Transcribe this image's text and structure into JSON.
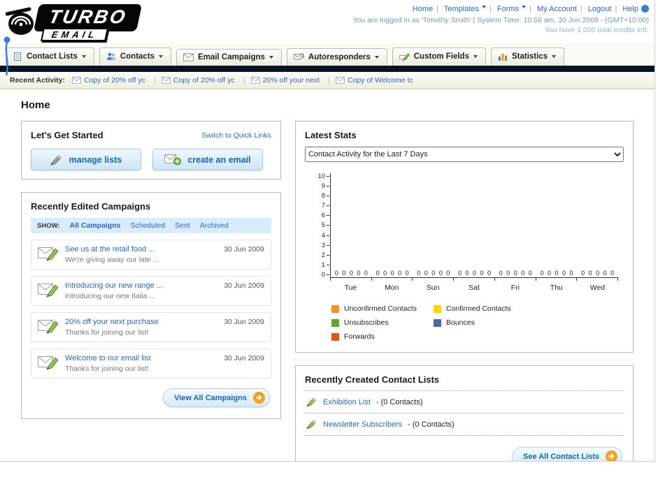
{
  "header": {
    "logo_top": "TURBO",
    "logo_bottom": "EMAIL",
    "links": [
      "Home",
      "Templates",
      "Forms",
      "My Account",
      "Logout",
      "Help"
    ],
    "status_line1": "You are logged in as 'Timothy Smith' | System Time: 10:58 am, 30 Jun 2009 - (GMT+10:00)",
    "status_line2": "You have 1,000 total credits left."
  },
  "nav": {
    "tabs": [
      "Contact Lists",
      "Contacts",
      "Email Campaigns",
      "Autoresponders",
      "Custom Fields",
      "Statistics"
    ]
  },
  "recent_activity": {
    "label": "Recent Activity:",
    "items": [
      {
        "label": "Copy of 20% off yc"
      },
      {
        "label": "Copy of 20% off yc"
      },
      {
        "label": "20% off your next"
      },
      {
        "label": "Copy of Welcome tc"
      }
    ]
  },
  "page": {
    "title": "Home"
  },
  "get_started": {
    "title": "Let's Get Started",
    "switch_link": "Switch to Quick Links",
    "manage_lists_label": "manage lists",
    "create_email_label": "create an email"
  },
  "campaigns": {
    "title": "Recently Edited Campaigns",
    "show_label": "SHOW:",
    "filters": [
      "All Campaigns",
      "Scheduled",
      "Sent",
      "Archived"
    ],
    "items": [
      {
        "title": "See us at the retail food ...",
        "subtitle": "We're giving away our late ...",
        "date": "30 Jun 2009"
      },
      {
        "title": "Introducing our new range ...",
        "subtitle": "Introducing our new Italia ...",
        "date": "30 Jun 2009"
      },
      {
        "title": "20% off your next purchase",
        "subtitle": "Thanks for joining our list!",
        "date": "30 Jun 2009"
      },
      {
        "title": "Welcome to our email list",
        "subtitle": "Thanks for joining our list!",
        "date": "30 Jun 2009"
      }
    ],
    "view_all_label": "View All Campaigns"
  },
  "stats": {
    "title": "Latest Stats",
    "dropdown_value": "Contact Activity for the Last 7 Days"
  },
  "chart_data": {
    "type": "bar",
    "title": "Contact Activity for the Last 7 Days",
    "categories": [
      "Tue",
      "Mon",
      "Sun",
      "Sat",
      "Fri",
      "Thu",
      "Wed"
    ],
    "series": [
      {
        "name": "Unconfirmed Contacts",
        "color": "#f7941d",
        "values": [
          0,
          0,
          0,
          0,
          0,
          0,
          0
        ]
      },
      {
        "name": "Confirmed Contacts",
        "color": "#ffd400",
        "values": [
          0,
          0,
          0,
          0,
          0,
          0,
          0
        ]
      },
      {
        "name": "Unsubscribes",
        "color": "#61a828",
        "values": [
          0,
          0,
          0,
          0,
          0,
          0,
          0
        ]
      },
      {
        "name": "Bounces",
        "color": "#4a69a5",
        "values": [
          0,
          0,
          0,
          0,
          0,
          0,
          0
        ]
      },
      {
        "name": "Forwards",
        "color": "#e8501d",
        "values": [
          0,
          0,
          0,
          0,
          0,
          0,
          0
        ]
      }
    ],
    "ylim": [
      0,
      10
    ],
    "ytick_step": 1,
    "grid": false,
    "legend_position": "bottom"
  },
  "contact_lists": {
    "title": "Recently Created Contact Lists",
    "items": [
      {
        "name": "Exhibition List",
        "suffix": "- (0 Contacts)"
      },
      {
        "name": "Newsletter Subscribers",
        "suffix": "- (0 Contacts)"
      }
    ],
    "see_all_label": "See All Contact Lists"
  },
  "colors": {
    "link": "#2a66c8",
    "accent_blue": "#1667ad",
    "dark_bar": "#0c1320",
    "orange_arrow": "#f6a21d"
  }
}
